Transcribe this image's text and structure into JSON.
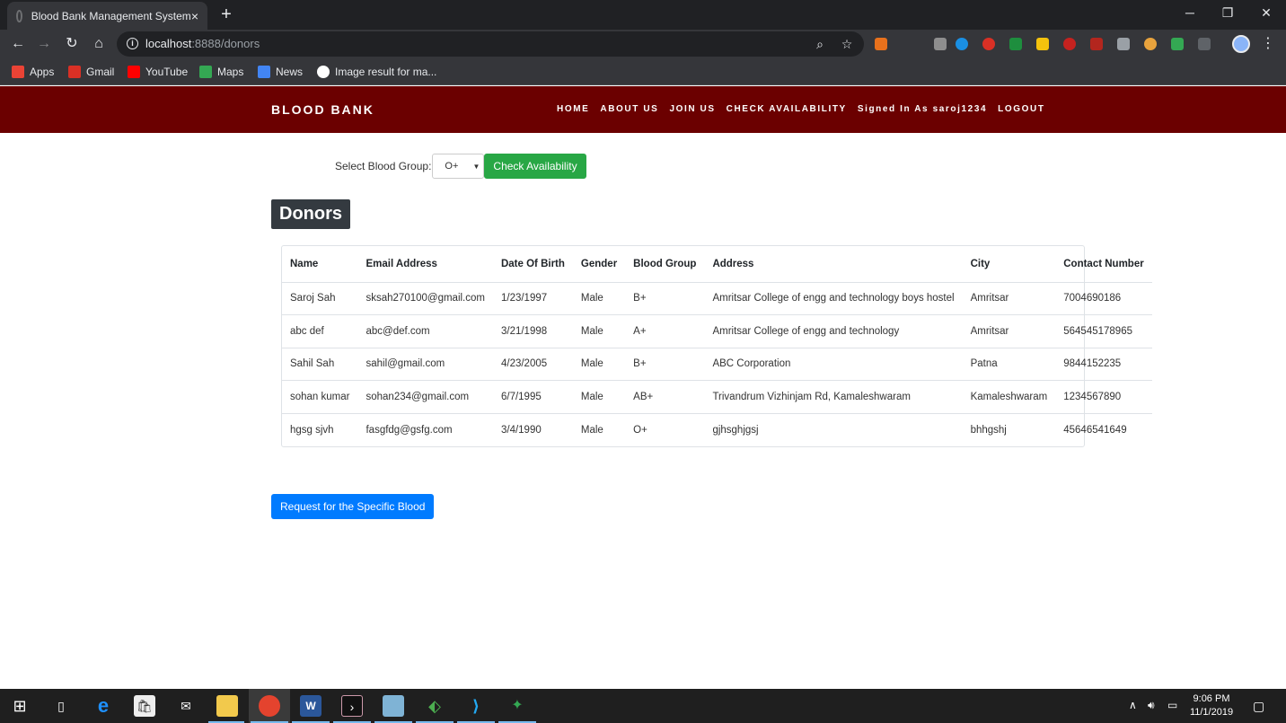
{
  "browser": {
    "tab_title": "Blood Bank Management System",
    "tab_close": "×",
    "new_tab": "+",
    "window_minimize": "─",
    "window_restore": "❐",
    "window_close": "✕",
    "url_host": "localhost",
    "url_path": ":8888/donors",
    "bookmarks": [
      "Apps",
      "Gmail",
      "YouTube",
      "Maps",
      "News",
      "Image result for ma..."
    ]
  },
  "site": {
    "brand": "BLOOD BANK",
    "nav": [
      "HOME",
      "ABOUT US",
      "JOIN US",
      "CHECK AVAILABILITY",
      "Signed In As saroj1234",
      "LOGOUT"
    ]
  },
  "filter": {
    "label": "Select Blood Group:",
    "selected": "O+",
    "button": "Check Availability"
  },
  "donors": {
    "title": "Donors",
    "columns": [
      "Name",
      "Email Address",
      "Date Of Birth",
      "Gender",
      "Blood Group",
      "Address",
      "City",
      "Contact Number"
    ],
    "rows": [
      [
        "Saroj Sah",
        "sksah270100@gmail.com",
        "1/23/1997",
        "Male",
        "B+",
        "Amritsar College of engg and technology boys hostel",
        "Amritsar",
        "7004690186"
      ],
      [
        "abc def",
        "abc@def.com",
        "3/21/1998",
        "Male",
        "A+",
        "Amritsar College of engg and technology",
        "Amritsar",
        "564545178965"
      ],
      [
        "Sahil Sah",
        "sahil@gmail.com",
        "4/23/2005",
        "Male",
        "B+",
        "ABC Corporation",
        "Patna",
        "9844152235"
      ],
      [
        "sohan kumar",
        "sohan234@gmail.com",
        "6/7/1995",
        "Male",
        "AB+",
        "Trivandrum Vizhinjam Rd, Kamaleshwaram",
        "Kamaleshwaram",
        "1234567890"
      ],
      [
        "hgsg sjvh",
        "fasgfdg@gsfg.com",
        "3/4/1990",
        "Male",
        "O+",
        "gjhsghjgsj",
        "bhhgshj",
        "45646541649"
      ]
    ]
  },
  "request_button": "Request for the Specific Blood",
  "taskbar": {
    "time": "9:06 PM",
    "date": "11/1/2019"
  },
  "colors": {
    "nav_bg": "#6b0000",
    "check_btn": "#28a745",
    "request_btn": "#007bff",
    "title_bg": "#343a40"
  }
}
